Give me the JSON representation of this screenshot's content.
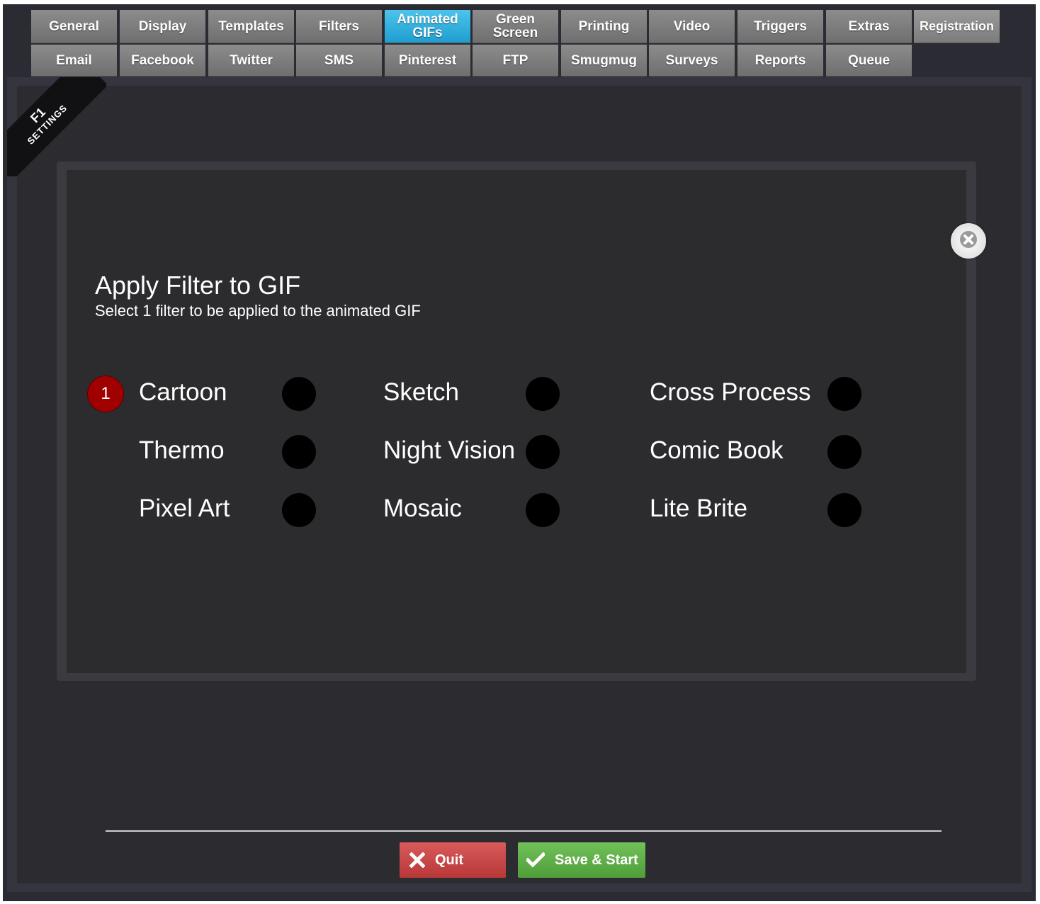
{
  "tabs": {
    "row1": [
      "General",
      "Display",
      "Templates",
      "Filters",
      "Animated GIFs",
      "Green Screen",
      "Printing",
      "Video",
      "Triggers",
      "Extras",
      "Registration"
    ],
    "row2": [
      "Email",
      "Facebook",
      "Twitter",
      "SMS",
      "Pinterest",
      "FTP",
      "Smugmug",
      "Surveys",
      "Reports",
      "Queue"
    ],
    "animated_line1": "Animated",
    "animated_line2": "GIFs",
    "green_line1": "Green",
    "green_line2": "Screen",
    "active": "Animated GIFs"
  },
  "ribbon": {
    "key": "F1",
    "label": "SETTINGS"
  },
  "dialog": {
    "title": "Apply Filter to GIF",
    "subtitle": "Select 1 filter to be applied to the animated GIF",
    "selected_count": "1",
    "filters": [
      "Cartoon",
      "Sketch",
      "Cross Process",
      "Thermo",
      "Night Vision",
      "Comic Book",
      "Pixel Art",
      "Mosaic",
      "Lite Brite"
    ]
  },
  "footer": {
    "quit_label": "Quit",
    "save_label": "Save & Start"
  },
  "colors": {
    "active_tab": "#2aaee0",
    "quit": "#c94545",
    "save": "#5fb047",
    "badge": "#a00000"
  },
  "icons": [
    "close-icon",
    "x-icon",
    "check-icon"
  ]
}
